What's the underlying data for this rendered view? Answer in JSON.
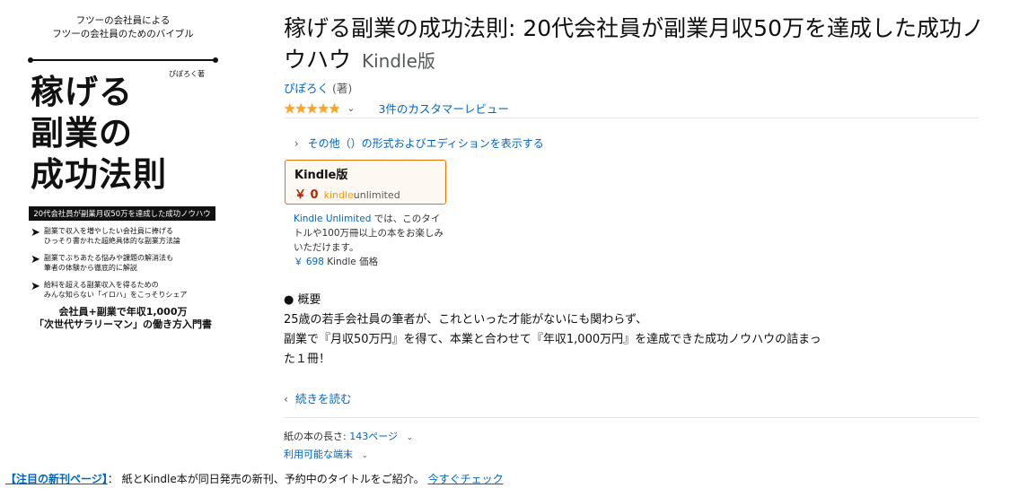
{
  "cover": {
    "top_line1": "フツーの会社員による",
    "top_line2": "フツーの会社員のためのバイブル",
    "author": "ぴぽろく著",
    "big_line1": "稼げる",
    "big_line2": "副業の",
    "big_line3": "成功法則",
    "band": "20代会社員が副業月収50万を達成した成功ノウハウ",
    "bullets": [
      {
        "line1": "副業で収入を増やしたい会社員に捧げる",
        "line2": "ひっそり書かれた超絶具体的な副業方法論"
      },
      {
        "line1": "副業でぶちあたる悩みや課題の解消法も",
        "line2": "筆者の体験から徹底的に解説"
      },
      {
        "line1": "給料を超える副業収入を得るための",
        "line2": "みんな知らない「イロハ」をこっそりシェア"
      }
    ],
    "bottom_line1": "会社員+副業で年収1,000万",
    "bottom_line2": "「次世代サラリーマン」の働き方入門書"
  },
  "product": {
    "title": "稼げる副業の成功法則: 20代会社員が副業月収50万を達成した成功ノウハウ",
    "format": "Kindle版",
    "author": "ぴぽろく",
    "author_role": "(著)",
    "stars": "★★★★★",
    "reviews_link": "3件のカスタマーレビュー",
    "editions_link": "その他（）の形式およびエディションを表示する"
  },
  "kindle_box": {
    "title": "Kindle版",
    "price": "￥ 0",
    "ku_prefix": "kindle",
    "ku_suffix": "unlimited"
  },
  "ku_note": {
    "link": "Kindle Unlimited",
    "text": " では、このタイトルや100万冊以上の本をお楽しみいただけます。",
    "price": "￥ 698",
    "price_label": " Kindle 価格"
  },
  "summary": {
    "heading": "● 概要",
    "line1": "25歳の若手会社員の筆者が、これといった才能がないにも関わらず、",
    "line2": "副業で『月収50万円』を得て、本業と合わせて『年収1,000万円』を達成できた成功ノウハウの詰まっ",
    "line3": "た１冊！",
    "read_more": "続きを読む"
  },
  "details": {
    "page_label": "紙の本の長さ: ",
    "page_value": "143ページ",
    "devices_label": "利用可能な端末"
  },
  "footer": {
    "badge": "【注目の新刊ページ】",
    "text": "： 紙とKindle本が同日発売の新刊、予約中のタイトルをご紹介。",
    "link": "今すぐチェック"
  }
}
